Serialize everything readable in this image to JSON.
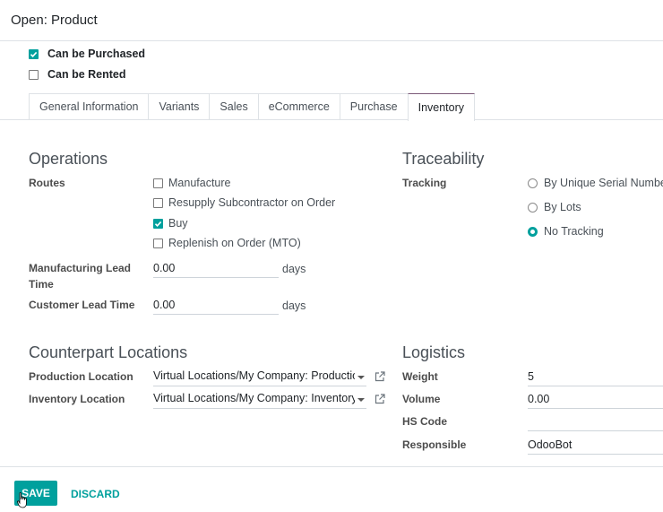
{
  "dialog": {
    "title": "Open: Product"
  },
  "top_checkboxes": [
    {
      "label": "Can be Purchased",
      "checked": true
    },
    {
      "label": "Can be Rented",
      "checked": false
    }
  ],
  "tabs": [
    {
      "label": "General Information",
      "active": false
    },
    {
      "label": "Variants",
      "active": false
    },
    {
      "label": "Sales",
      "active": false
    },
    {
      "label": "eCommerce",
      "active": false
    },
    {
      "label": "Purchase",
      "active": false
    },
    {
      "label": "Inventory",
      "active": true
    }
  ],
  "operations": {
    "title": "Operations",
    "routes_label": "Routes",
    "routes": [
      {
        "label": "Manufacture",
        "checked": false
      },
      {
        "label": "Resupply Subcontractor on Order",
        "checked": false
      },
      {
        "label": "Buy",
        "checked": true
      },
      {
        "label": "Replenish on Order (MTO)",
        "checked": false
      }
    ],
    "manufacturing_lead_label_1": "Manufacturing Lead",
    "manufacturing_lead_label_2": "Time",
    "manufacturing_lead_value": "0.00",
    "customer_lead_label": "Customer Lead Time",
    "customer_lead_value": "0.00",
    "unit": "days"
  },
  "traceability": {
    "title": "Traceability",
    "tracking_label": "Tracking",
    "options": [
      {
        "label": "By Unique Serial Number",
        "selected": false
      },
      {
        "label": "By Lots",
        "selected": false
      },
      {
        "label": "No Tracking",
        "selected": true
      }
    ]
  },
  "counterpart": {
    "title": "Counterpart Locations",
    "production_label": "Production Location",
    "production_value": "Virtual Locations/My Company: Production",
    "inventory_label": "Inventory Location",
    "inventory_value": "Virtual Locations/My Company: Inventory adjustment"
  },
  "logistics": {
    "title": "Logistics",
    "weight_label": "Weight",
    "weight_value": "5",
    "volume_label": "Volume",
    "volume_value": "0.00",
    "hs_code_label": "HS Code",
    "hs_code_value": "",
    "responsible_label": "Responsible",
    "responsible_value": "OdooBot"
  },
  "footer": {
    "save_label": "SAVE",
    "discard_label": "DISCARD"
  },
  "colors": {
    "accent": "#00a09d",
    "tab_active_top": "#7c5a78"
  },
  "icons": [
    "check-icon",
    "external-link-icon",
    "caret-down-icon",
    "pointer-cursor-icon"
  ]
}
